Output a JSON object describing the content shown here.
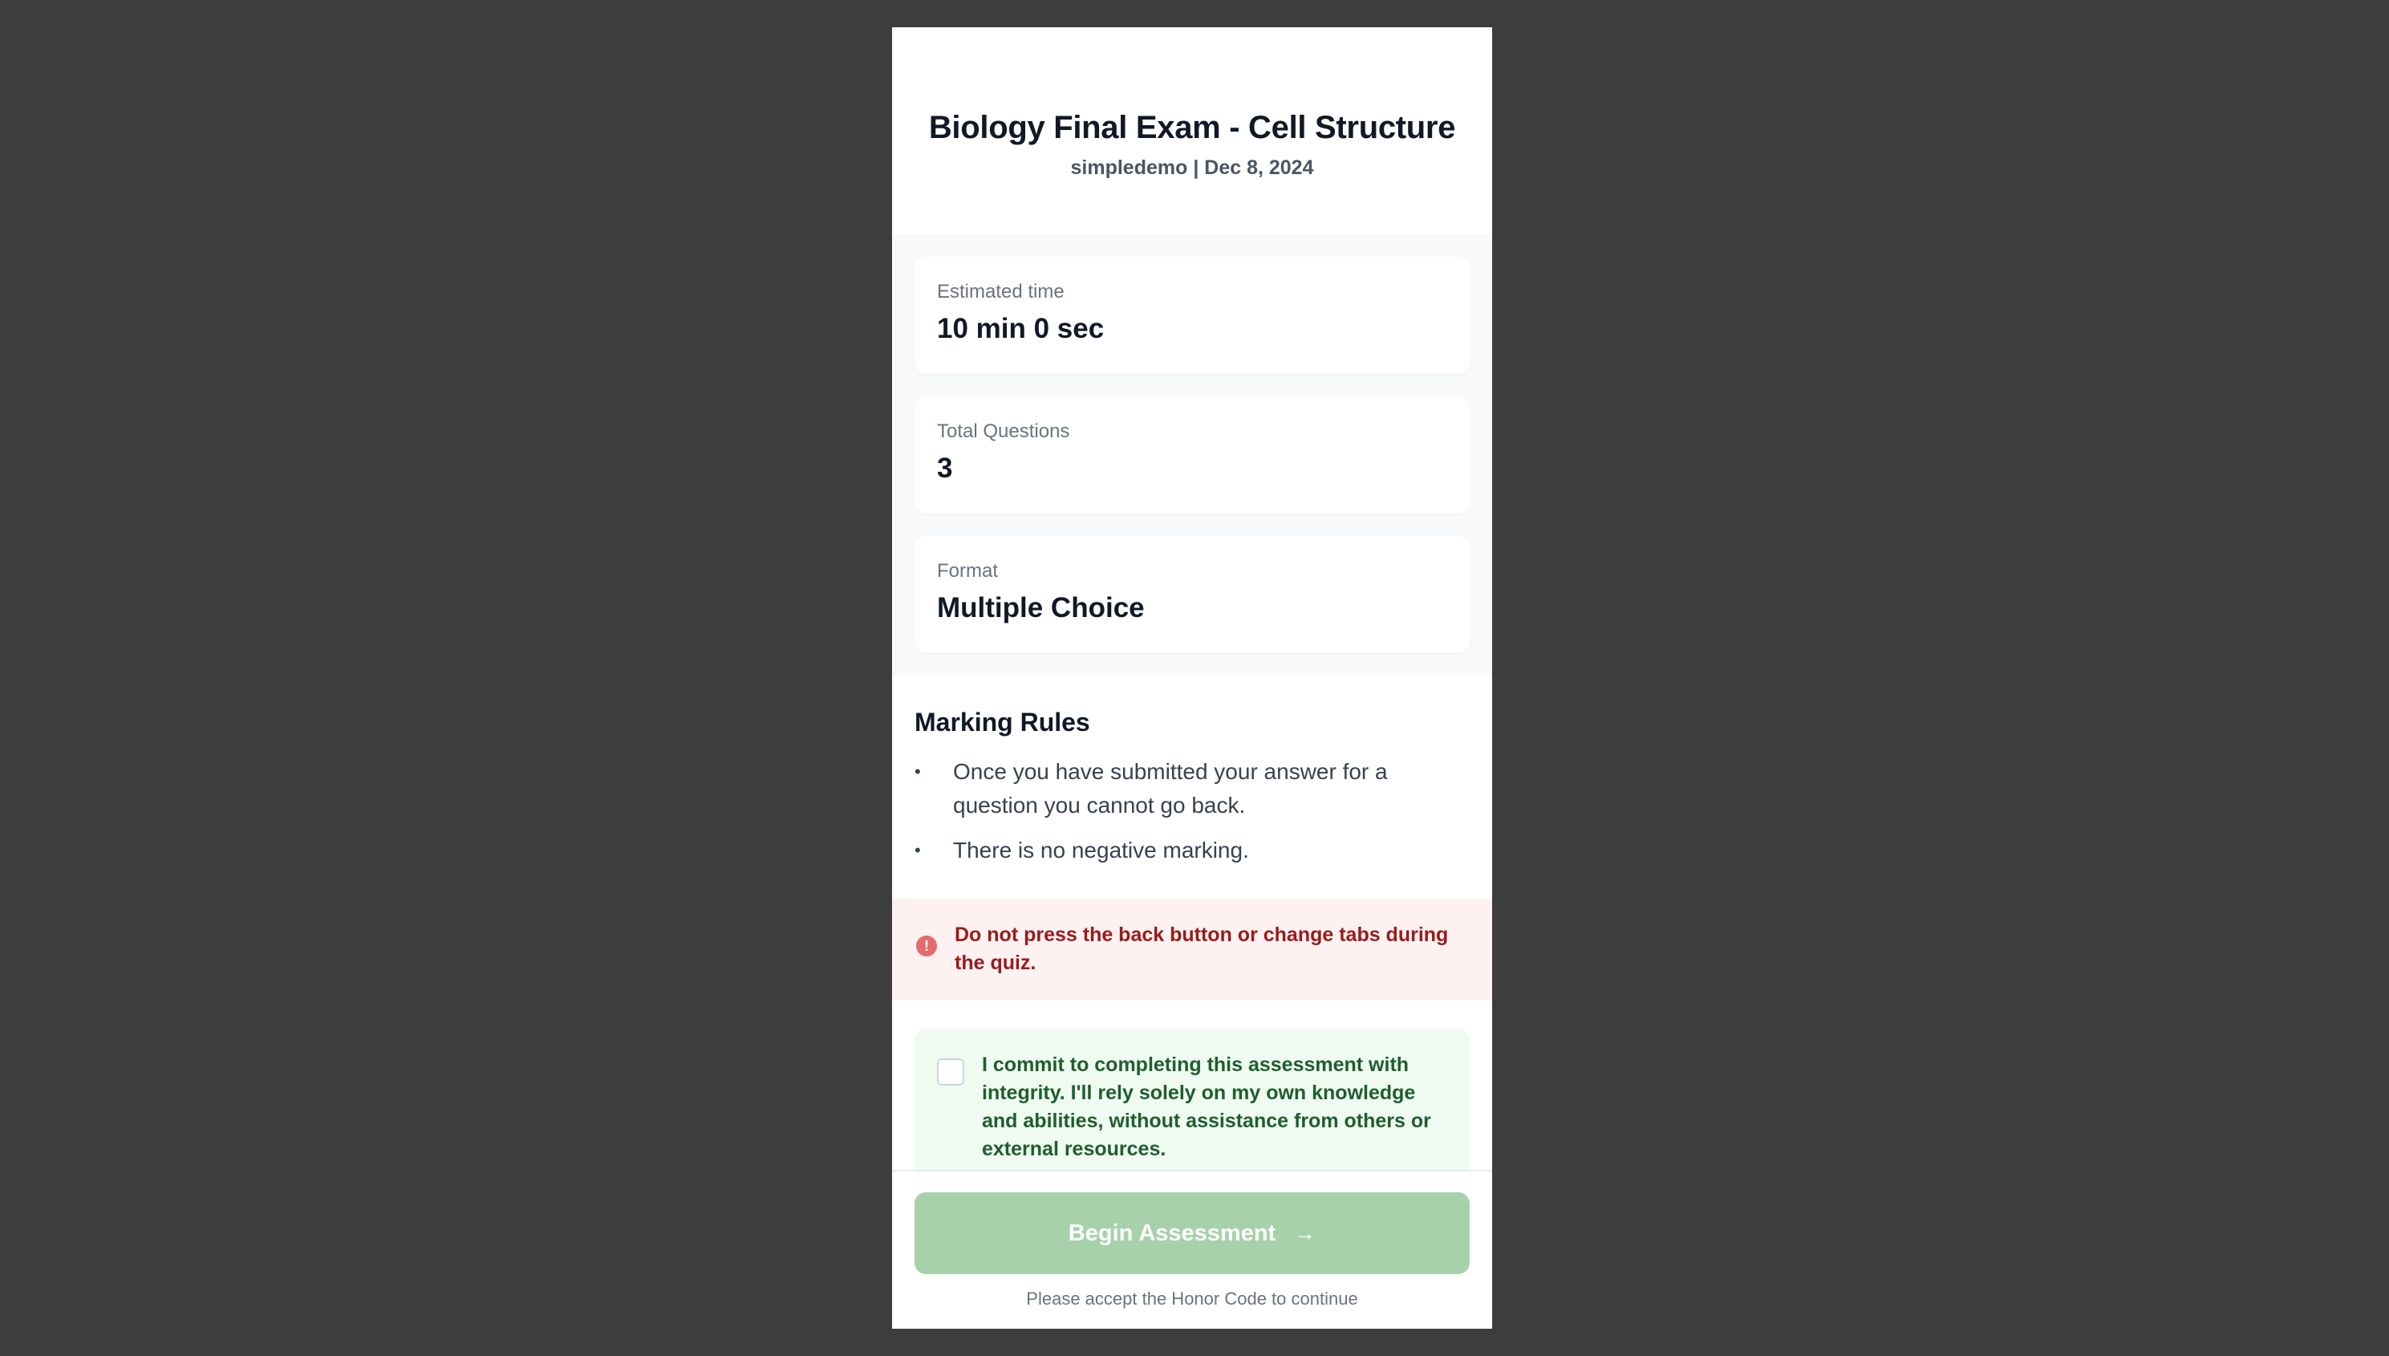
{
  "header": {
    "title": "Biology Final Exam - Cell Structure",
    "subtitle": "simpledemo | Dec 8, 2024"
  },
  "info_cards": [
    {
      "label": "Estimated time",
      "value": "10 min 0 sec"
    },
    {
      "label": "Total Questions",
      "value": "3"
    },
    {
      "label": "Format",
      "value": "Multiple Choice"
    }
  ],
  "rules": {
    "title": "Marking Rules",
    "bullet": "•",
    "items": [
      "Once you have submitted your answer for a question you cannot go back.",
      "There is no negative marking."
    ]
  },
  "warning": {
    "icon": "!",
    "icon_name": "alert-circle-icon",
    "text": "Do not press the back button or change tabs during the quiz.",
    "color": "#991b1b",
    "background": "#fdf1f1"
  },
  "honor_code": {
    "checked": false,
    "text": "I commit to completing this assessment with integrity. I'll rely solely on my own knowledge and abilities, without assistance from others or external resources."
  },
  "footer": {
    "button_label": "Begin Assessment",
    "button_icon": "→",
    "button_icon_name": "arrow-right-icon",
    "button_color": "#a7d1aa",
    "hint": "Please accept the Honor Code to continue"
  }
}
